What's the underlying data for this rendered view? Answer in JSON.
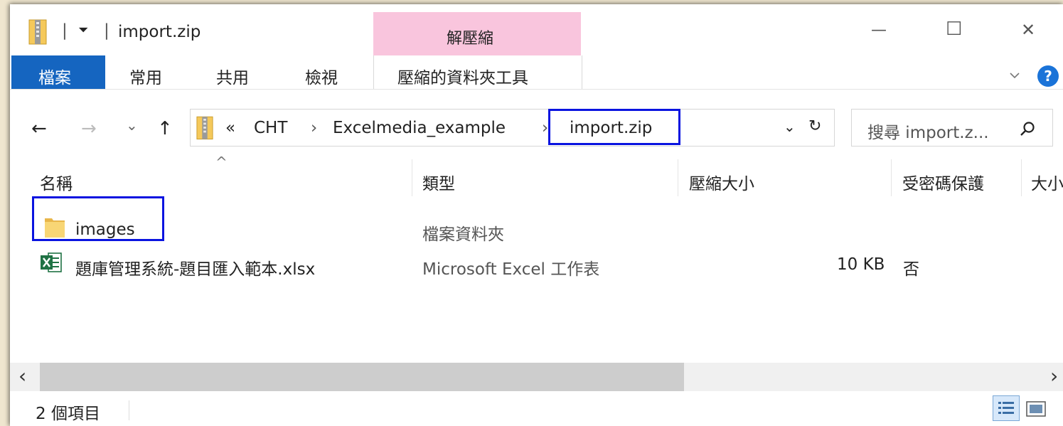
{
  "window": {
    "title": "import.zip",
    "contextual_tab_group": "解壓縮",
    "controls": {
      "minimize": "—",
      "maximize": "☐",
      "close": "✕"
    }
  },
  "quick_access": {
    "separator1": "|",
    "dropdown": "⏷",
    "separator2": "|"
  },
  "ribbon": {
    "tabs": [
      {
        "label": "檔案",
        "active": true
      },
      {
        "label": "常用"
      },
      {
        "label": "共用"
      },
      {
        "label": "檢視"
      },
      {
        "label": "壓縮的資料夾工具"
      }
    ],
    "expand_icon": "chevron-down-icon",
    "help_icon": "help-icon",
    "help_glyph": "?"
  },
  "navigation": {
    "back": "←",
    "forward": "→",
    "recent": "⌄",
    "up": "↑",
    "address": {
      "overflow": "«",
      "segments": [
        "CHT",
        "Excelmedia_example",
        "import.zip"
      ],
      "separator": "›",
      "dropdown": "⌄",
      "refresh": "↻"
    },
    "search": {
      "placeholder": "搜尋 import.z...",
      "icon": "search-icon"
    }
  },
  "columns": {
    "sort_indicator": "^",
    "headers": [
      "名稱",
      "類型",
      "壓縮大小",
      "受密碼保護",
      "大小"
    ]
  },
  "files": [
    {
      "name": "images",
      "type": "檔案資料夾",
      "compressed_size": "",
      "password": "",
      "icon": "folder-icon"
    },
    {
      "name": "題庫管理系統-題目匯入範本.xlsx",
      "type": "Microsoft Excel 工作表",
      "compressed_size": "10 KB",
      "password": "否",
      "icon": "excel-file-icon"
    }
  ],
  "scrollbar": {
    "left": "‹",
    "right": "›"
  },
  "status": {
    "item_count": "2 個項目"
  },
  "colors": {
    "file_tab": "#1565c0",
    "contextual_tab": "#f9c5dd",
    "highlight": "#0a14e0",
    "folder": "#f5c95b",
    "excel": "#1f7244"
  }
}
